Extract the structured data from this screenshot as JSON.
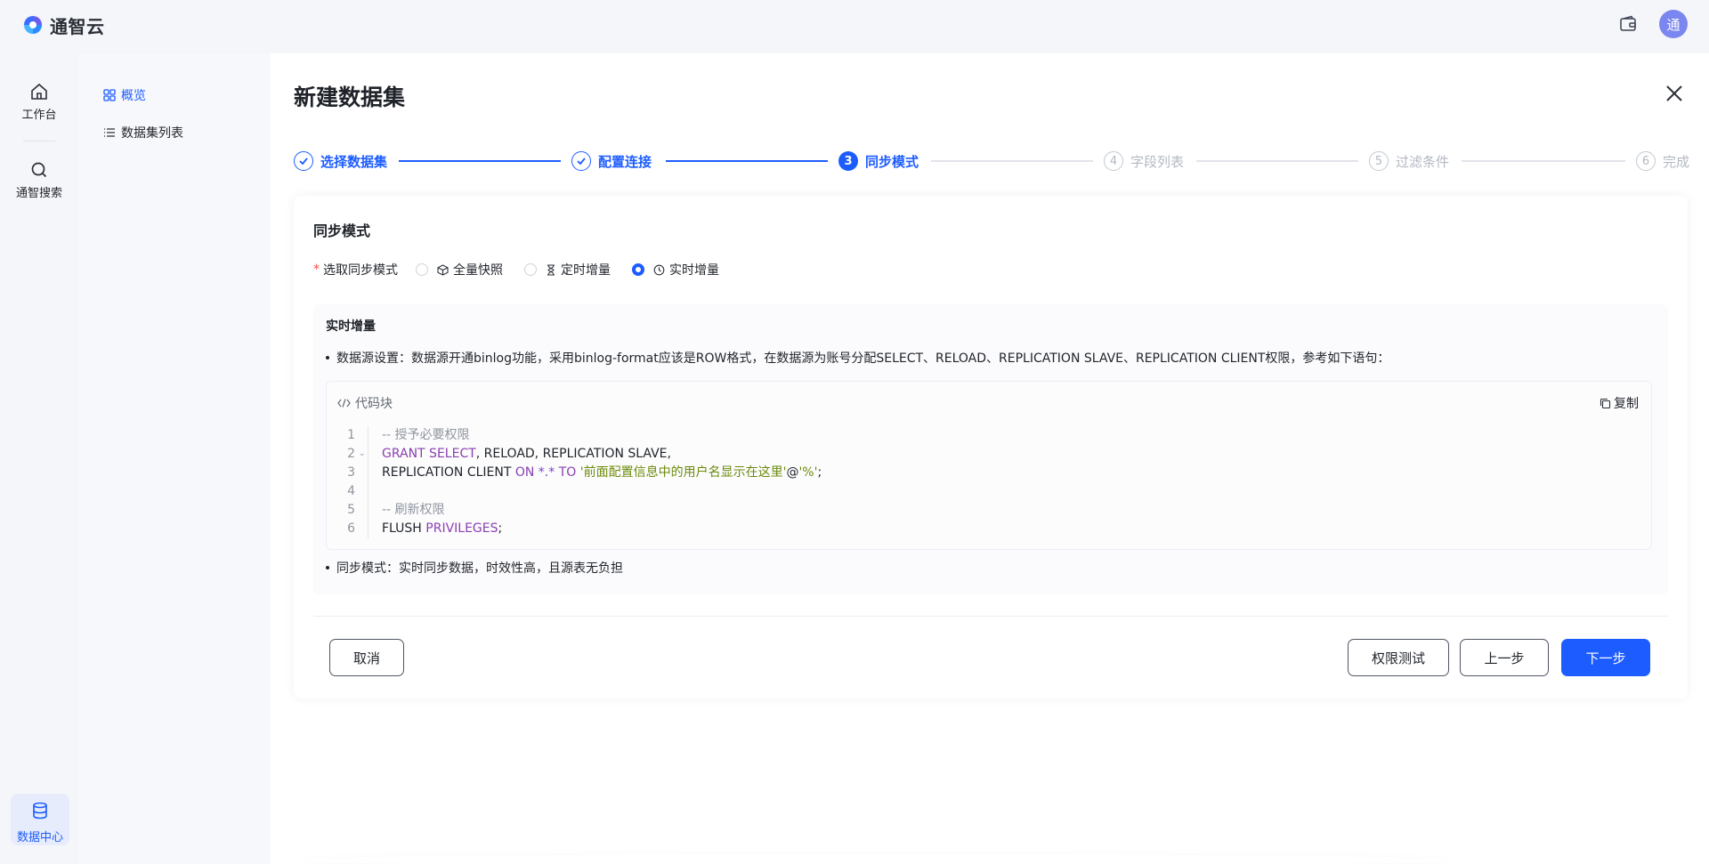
{
  "brand": {
    "name": "通智云",
    "avatar_text": "通"
  },
  "rail": {
    "items": [
      {
        "label": "工作台",
        "icon": "home-icon"
      },
      {
        "label": "通智搜索",
        "icon": "search-icon"
      }
    ],
    "active": {
      "label": "数据中心",
      "icon": "database-icon"
    }
  },
  "submenu": {
    "items": [
      {
        "label": "概览",
        "icon": "grid-icon",
        "active": true
      },
      {
        "label": "数据集列表",
        "icon": "list-icon",
        "active": false
      }
    ]
  },
  "page": {
    "title": "新建数据集"
  },
  "steps": [
    {
      "num": "1",
      "label": "选择数据集",
      "state": "done"
    },
    {
      "num": "2",
      "label": "配置连接",
      "state": "done"
    },
    {
      "num": "3",
      "label": "同步模式",
      "state": "current"
    },
    {
      "num": "4",
      "label": "字段列表",
      "state": "pending"
    },
    {
      "num": "5",
      "label": "过滤条件",
      "state": "pending"
    },
    {
      "num": "6",
      "label": "完成",
      "state": "pending"
    }
  ],
  "sync": {
    "section_title": "同步模式",
    "field_label": "选取同步模式",
    "options": [
      {
        "label": "全量快照",
        "icon": "cube-icon",
        "checked": false
      },
      {
        "label": "定时增量",
        "icon": "hourglass-icon",
        "checked": false
      },
      {
        "label": "实时增量",
        "icon": "clock-icon",
        "checked": true
      }
    ]
  },
  "info": {
    "title": "实时增量",
    "bullet1": "数据源设置：数据源开通binlog功能，采用binlog-format应该是ROW格式，在数据源为账号分配SELECT、RELOAD、REPLICATION SLAVE、REPLICATION CLIENT权限，参考如下语句：",
    "bullet2": "同步模式：实时同步数据，时效性高，且源表无负担",
    "code_label": "代码块",
    "copy_label": "复制",
    "code": {
      "line1": "-- 授予必要权限",
      "line2_kw": "GRANT SELECT",
      "line2_rest": ", RELOAD, REPLICATION SLAVE,",
      "line3_a": "REPLICATION CLIENT ",
      "line3_on": "ON",
      "line3_star": " *.* ",
      "line3_to": "TO",
      "line3_str": " '前面配置信息中的用户名显示在这里'",
      "line3_at": "@",
      "line3_pct": "'%'",
      "line3_end": ";",
      "line5": "-- 刷新权限",
      "line6_a": "FLUSH ",
      "line6_kw": "PRIVILEGES",
      "line6_end": ";",
      "line_numbers": [
        "1",
        "2",
        "3",
        "4",
        "5",
        "6"
      ]
    }
  },
  "buttons": {
    "cancel": "取消",
    "permission_test": "权限测试",
    "prev": "上一步",
    "next": "下一步"
  },
  "colors": {
    "primary": "#1d5cff",
    "required": "#f54a45"
  }
}
